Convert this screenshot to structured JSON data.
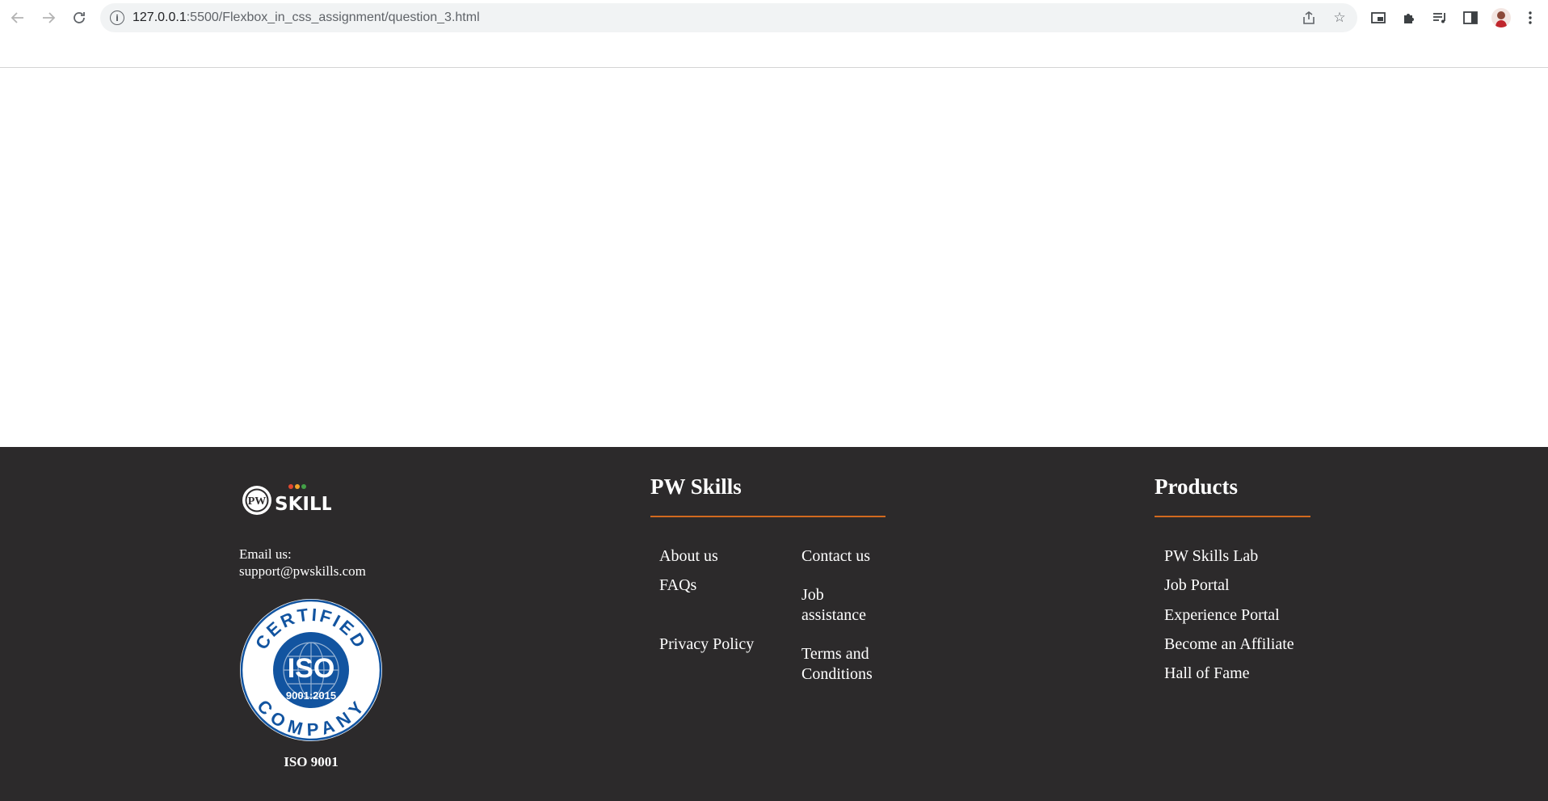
{
  "browser": {
    "url_host": "127.0.0.1",
    "url_path": ":5500/Flexbox_in_css_assignment/question_3.html",
    "icons": [
      "back-icon",
      "forward-icon",
      "reload-icon",
      "site-info-icon",
      "share-icon",
      "bookmark-star-icon",
      "picture-in-picture-icon",
      "extensions-icon",
      "media-control-icon",
      "side-panel-icon",
      "profile-avatar",
      "menu-icon"
    ]
  },
  "footer": {
    "background": "#2c2a2b",
    "accent": "#d2691e",
    "brand": {
      "logo_text": "SKILLS",
      "logo_mark": "PW",
      "email_label": "Email us:",
      "email_value": "support@pwskills.com",
      "iso_badge": {
        "top_text": "CERTIFIED",
        "center_text": "ISO",
        "standard": "9001:2015",
        "bottom_text": "COMPANY",
        "color": "#1254a0"
      },
      "iso_caption": "ISO 9001"
    },
    "pw_skills": {
      "heading": "PW Skills",
      "links_left": [
        "About us",
        "FAQs",
        "Privacy Policy"
      ],
      "links_right": [
        "Contact us",
        "Job assistance",
        "Terms and Conditions"
      ]
    },
    "products": {
      "heading": "Products",
      "links": [
        "PW Skills Lab",
        "Job Portal",
        "Experience Portal",
        "Become an Affiliate",
        "Hall of Fame"
      ]
    }
  }
}
